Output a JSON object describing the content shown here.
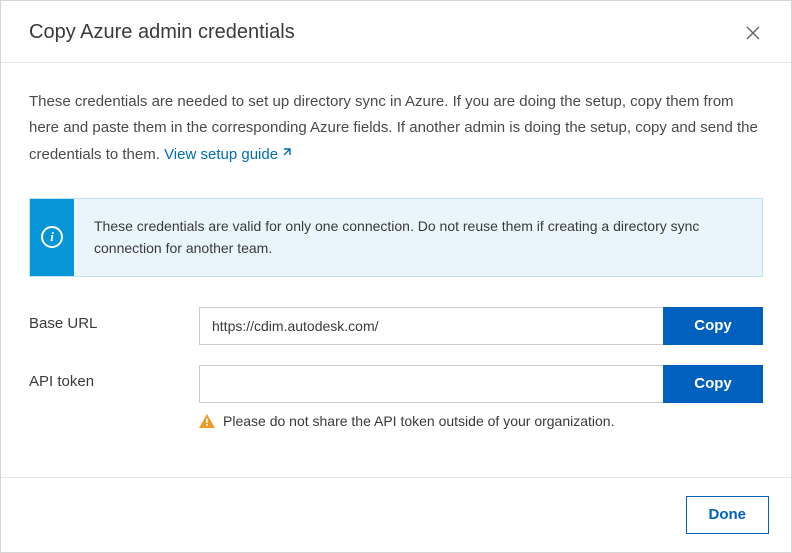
{
  "header": {
    "title": "Copy Azure admin credentials"
  },
  "description": {
    "text": "These credentials are needed to set up directory sync in Azure. If you are doing the setup, copy them from here and paste them in the corresponding Azure fields. If another admin is doing the setup, copy and send the credentials to them. ",
    "link_label": "View setup guide"
  },
  "info": {
    "text": "These credentials are valid for only one connection. Do not reuse them if creating a directory sync connection for another team."
  },
  "fields": {
    "base_url": {
      "label": "Base URL",
      "value": "https://cdim.autodesk.com/",
      "copy_label": "Copy"
    },
    "api_token": {
      "label": "API token",
      "value": "",
      "copy_label": "Copy",
      "warning": "Please do not share the API token outside of your organization."
    }
  },
  "footer": {
    "done_label": "Done"
  }
}
